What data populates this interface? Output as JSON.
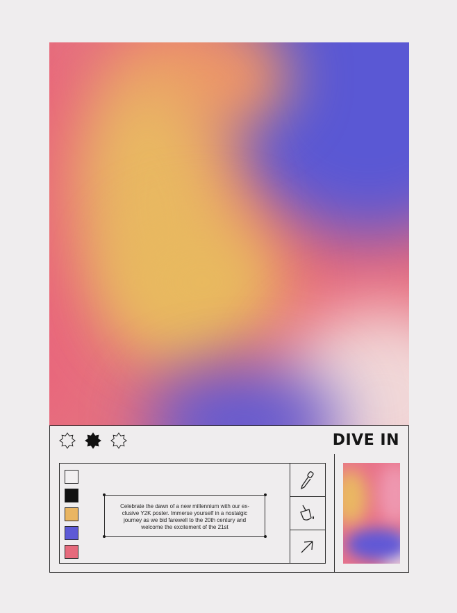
{
  "title": "DIVE IN",
  "description": "Celebrate the dawn of a new millennium with our ex-clusive Y2K poster. Immerse yourself in a nostalgic journey as we bid farewell to the 20th century and welcome the excitement of the 21st",
  "description_lines": [
    "Celebrate the dawn of a new millennium with our ex-",
    "clusive Y2K poster. Immerse yourself in a nostalgic",
    "journey as we bid farewell to the 20th century and",
    "welcome the excitement of the 21st"
  ],
  "stars": [
    {
      "name": "star-outline-icon",
      "filled": false
    },
    {
      "name": "star-filled-icon",
      "filled": true
    },
    {
      "name": "star-outline-icon",
      "filled": false
    }
  ],
  "palette": [
    "#f2f0f1",
    "#111111",
    "#e9b562",
    "#5d5ad6",
    "#e66a7c"
  ],
  "tools": [
    "eyedropper-icon",
    "paint-bucket-icon",
    "cursor-arrow-icon"
  ],
  "gradient_colors": {
    "coral": "#e6707f",
    "yellow": "#e9b862",
    "blue": "#5a58d4",
    "pale": "#f1d8d8"
  }
}
